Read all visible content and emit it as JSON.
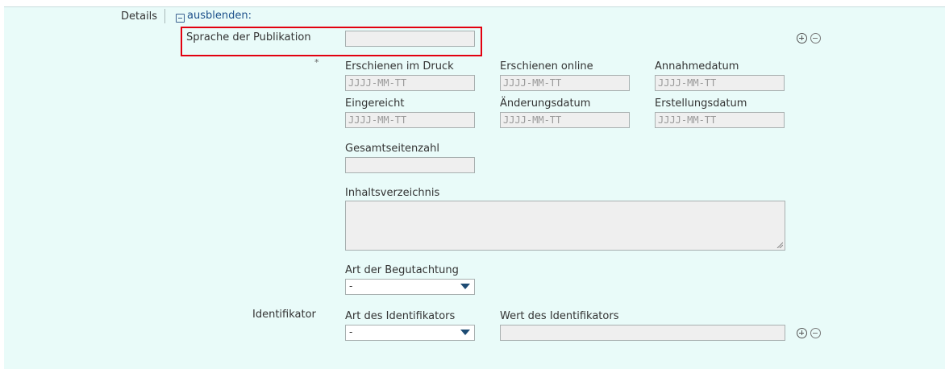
{
  "details": {
    "label": "Details",
    "toggle_label": "ausblenden:"
  },
  "language": {
    "label": "Sprache der Publikation",
    "value": ""
  },
  "required_marker": "*",
  "dates": [
    {
      "label": "Erschienen im Druck",
      "placeholder": "JJJJ-MM-TT"
    },
    {
      "label": "Erschienen online",
      "placeholder": "JJJJ-MM-TT"
    },
    {
      "label": "Annahmedatum",
      "placeholder": "JJJJ-MM-TT"
    },
    {
      "label": "Eingereicht",
      "placeholder": "JJJJ-MM-TT"
    },
    {
      "label": "Änderungsdatum",
      "placeholder": "JJJJ-MM-TT"
    },
    {
      "label": "Erstellungsdatum",
      "placeholder": "JJJJ-MM-TT"
    }
  ],
  "total_pages": {
    "label": "Gesamtseitenzahl",
    "value": ""
  },
  "toc": {
    "label": "Inhaltsverzeichnis",
    "value": ""
  },
  "review_type": {
    "label": "Art der Begutachtung",
    "selected": "-"
  },
  "identifier": {
    "section_label": "Identifikator",
    "type_label": "Art des Identifikators",
    "type_selected": "-",
    "value_label": "Wert des Identifikators",
    "value": ""
  },
  "icons": {
    "add": "circle-plus-icon",
    "remove": "circle-minus-icon",
    "collapse": "square-minus-icon",
    "dropdown": "caret-down-icon"
  },
  "colors": {
    "panel_background": "#e9fbf9",
    "highlight": "#e3000f",
    "link": "#1b4f8a"
  }
}
